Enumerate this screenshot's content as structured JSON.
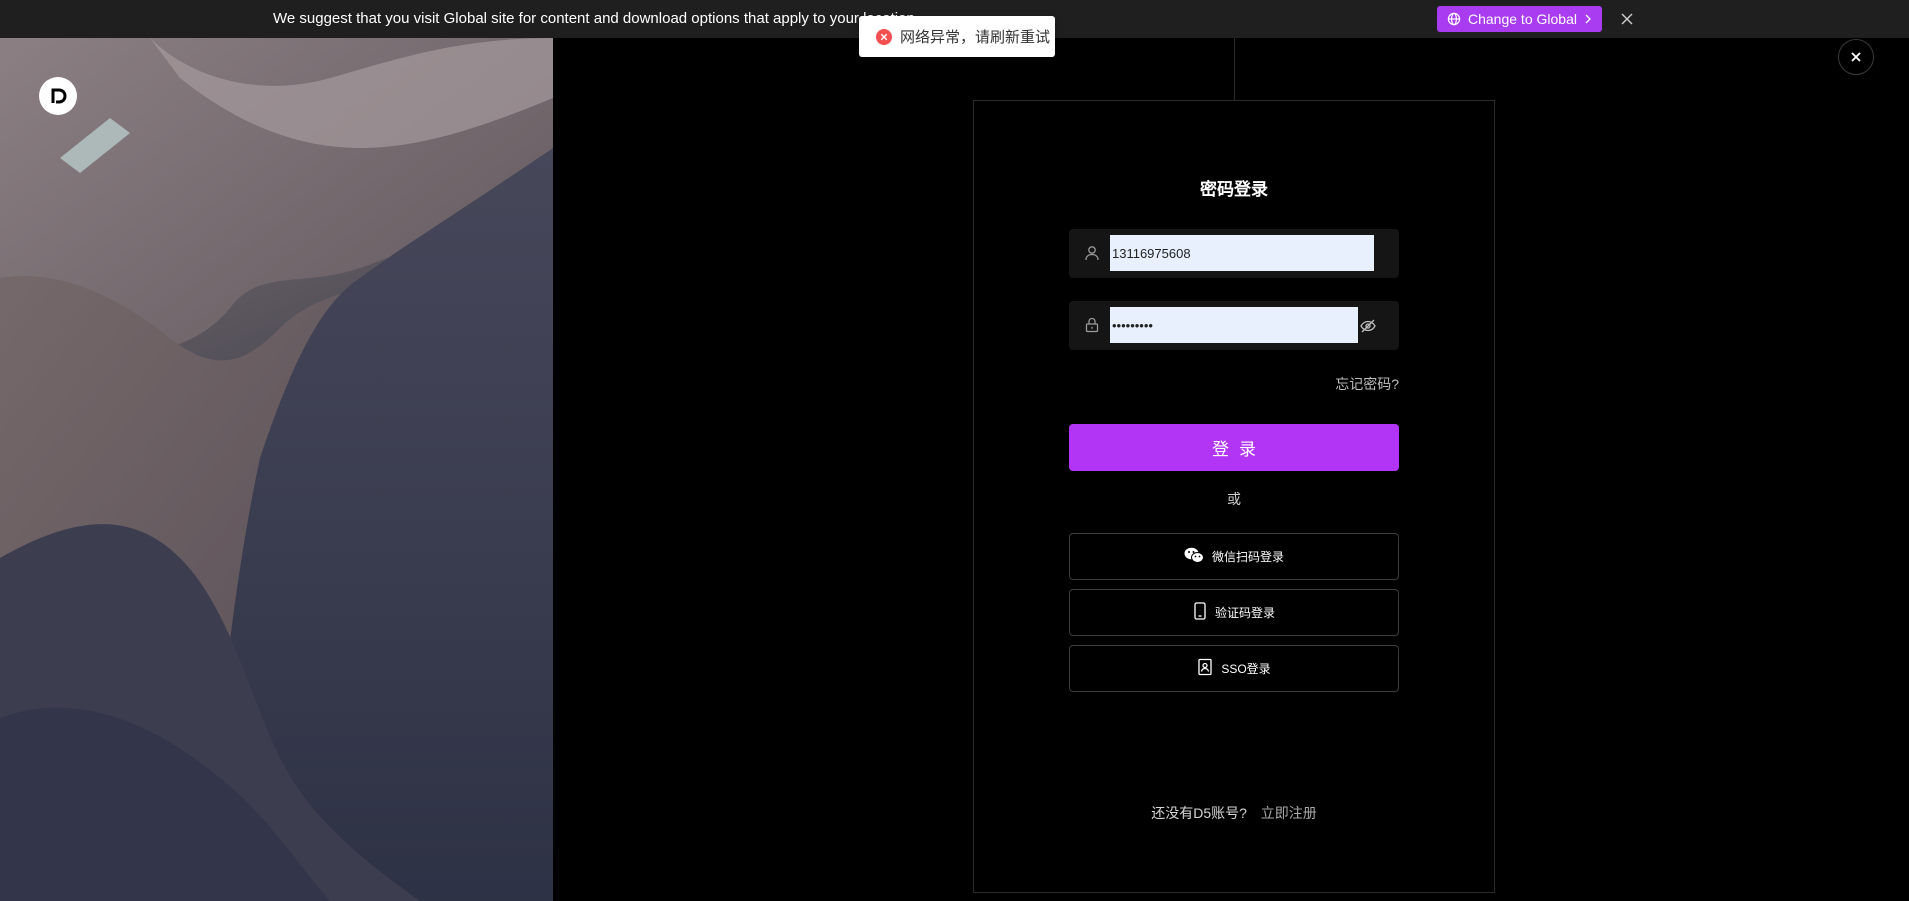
{
  "banner": {
    "text": "We suggest that you visit Global site for content and download options that apply to your location",
    "change_label": "Change to Global",
    "change_icon": "globe-icon"
  },
  "toast": {
    "message": "网络异常，请刷新重试",
    "icon": "error-circle-icon",
    "color": "#f0504f"
  },
  "login": {
    "title": "密码登录",
    "phone_value": "13116975608",
    "password_value": "•••••••••",
    "forgot_label": "忘记密码?",
    "submit_label": "登录",
    "or_label": "或",
    "alt_methods": [
      {
        "label": "微信扫码登录",
        "icon": "wechat-icon"
      },
      {
        "label": "验证码登录",
        "icon": "mobile-icon"
      },
      {
        "label": "SSO登录",
        "icon": "badge-icon"
      }
    ],
    "signup_prompt": "还没有D5账号?",
    "signup_link": "立即注册"
  },
  "colors": {
    "accent": "#b235f5",
    "banner_button": "#a93bf0",
    "input_bg": "#e8f0fe"
  }
}
